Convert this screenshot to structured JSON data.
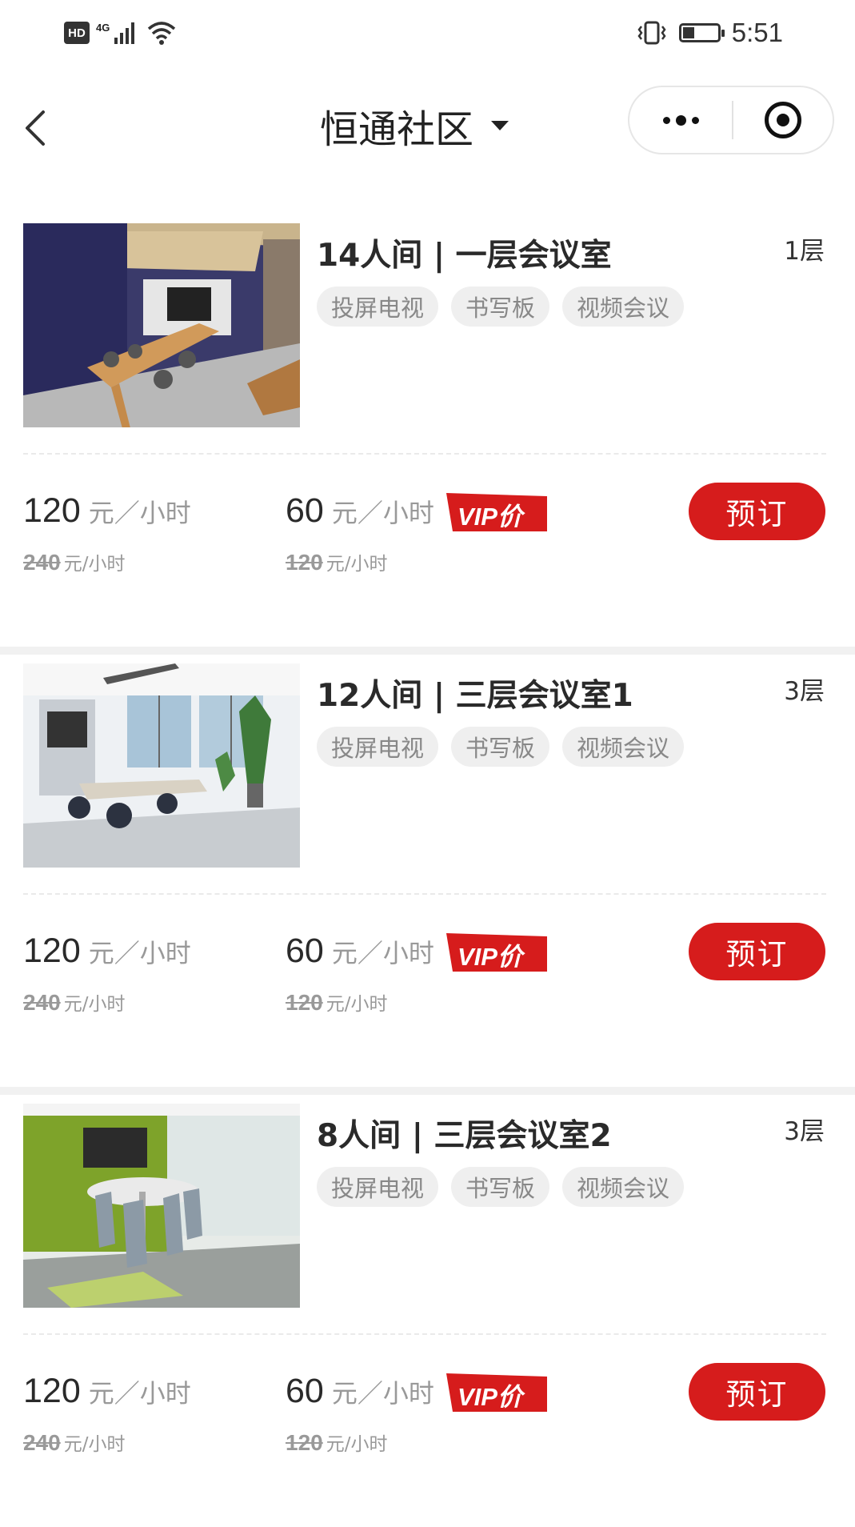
{
  "status_bar": {
    "hd": "HD",
    "network": "4G",
    "time": "5:51"
  },
  "nav": {
    "title": "恒通社区",
    "icons": [
      "back-icon",
      "dropdown-caret-icon",
      "more-icon",
      "close-miniprogram-icon"
    ]
  },
  "rooms": [
    {
      "name": "14人间 | 一层会议室",
      "floor": "1层",
      "tags": [
        "投屏电视",
        "书写板",
        "视频会议"
      ],
      "price": "120",
      "price_unit": "元／小时",
      "original_price": "240",
      "original_unit": "元/小时",
      "vip_price": "60",
      "vip_unit": "元／小时",
      "vip_original_price": "120",
      "vip_original_unit": "元/小时",
      "vip_label": "VIP价",
      "book_label": "预订"
    },
    {
      "name": "12人间 | 三层会议室1",
      "floor": "3层",
      "tags": [
        "投屏电视",
        "书写板",
        "视频会议"
      ],
      "price": "120",
      "price_unit": "元／小时",
      "original_price": "240",
      "original_unit": "元/小时",
      "vip_price": "60",
      "vip_unit": "元／小时",
      "vip_original_price": "120",
      "vip_original_unit": "元/小时",
      "vip_label": "VIP价",
      "book_label": "预订"
    },
    {
      "name": "8人间 | 三层会议室2",
      "floor": "3层",
      "tags": [
        "投屏电视",
        "书写板",
        "视频会议"
      ],
      "price": "120",
      "price_unit": "元／小时",
      "original_price": "240",
      "original_unit": "元/小时",
      "vip_price": "60",
      "vip_unit": "元／小时",
      "vip_original_price": "120",
      "vip_original_unit": "元/小时",
      "vip_label": "VIP价",
      "book_label": "预订"
    }
  ],
  "colors": {
    "accent_red": "#d61c1c",
    "tag_bg": "#efefef",
    "section_gap": "#f1f1f1"
  }
}
